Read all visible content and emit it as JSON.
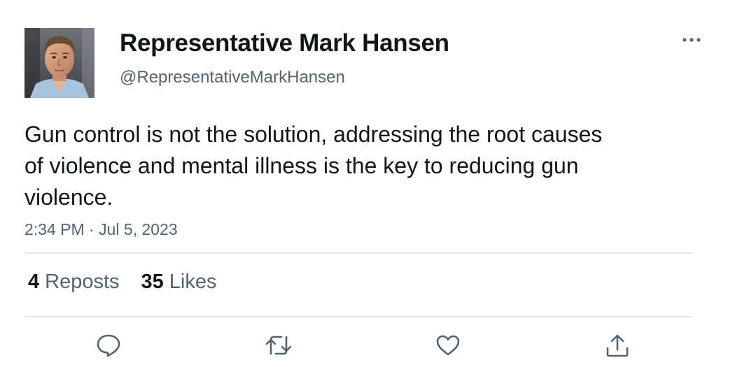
{
  "author": {
    "display_name": "Representative Mark Hansen",
    "handle": "@RepresentativeMarkHansen",
    "avatar_icon": "profile-photo"
  },
  "tweet": {
    "text": "Gun control is not the solution, addressing the root causes of violence and mental illness is the key to reducing gun violence.",
    "timestamp": "2:34 PM · Jul 5, 2023"
  },
  "stats": {
    "reposts_count": "4",
    "reposts_label": "Reposts",
    "likes_count": "35",
    "likes_label": "Likes"
  },
  "actions": [
    {
      "icon": "reply-icon"
    },
    {
      "icon": "repost-icon"
    },
    {
      "icon": "like-icon"
    },
    {
      "icon": "share-icon"
    }
  ],
  "menu": {
    "icon": "more-icon"
  },
  "colors": {
    "text_primary": "#0f1419",
    "text_secondary": "#536471",
    "divider": "#e6e9ec",
    "icon": "#536471"
  }
}
